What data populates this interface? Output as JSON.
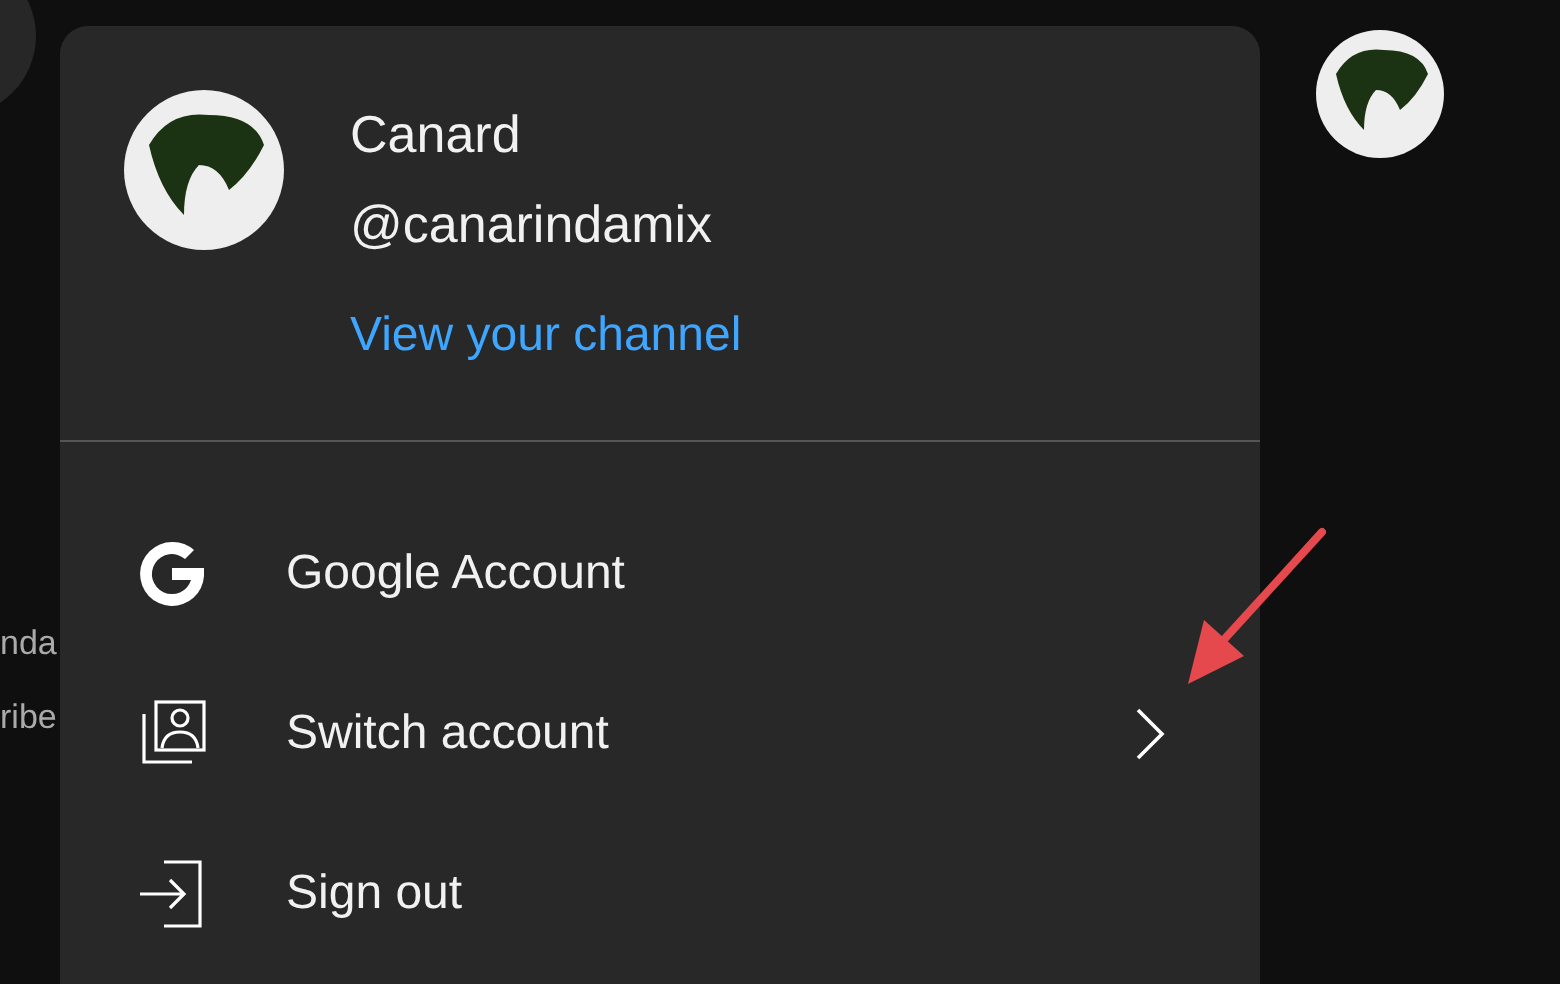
{
  "background_texts": [
    "nda",
    "ribe"
  ],
  "account": {
    "name": "Canard",
    "handle": "@canarindamix",
    "link": "View your channel"
  },
  "menu_items": [
    {
      "kind": "google",
      "label": "Google Account",
      "has_submenu": false
    },
    {
      "kind": "switch",
      "label": "Switch account",
      "has_submenu": true
    },
    {
      "kind": "signout",
      "label": "Sign out",
      "has_submenu": false
    }
  ]
}
